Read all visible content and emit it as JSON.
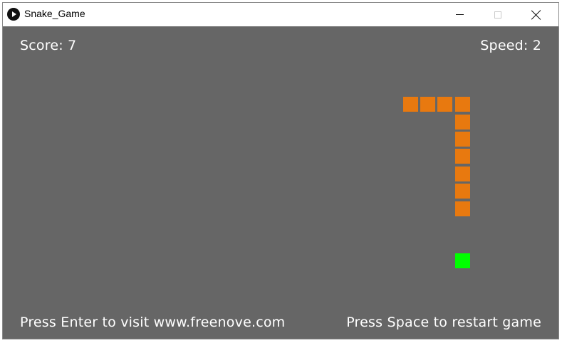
{
  "window": {
    "title": "Snake_Game",
    "app_icon": "play-icon",
    "controls": [
      "minimize-icon",
      "maximize-icon",
      "close-icon"
    ]
  },
  "hud": {
    "score_text": "Score: 7",
    "speed_text": "Speed: 2",
    "enter_hint": "Press Enter to visit www.freenove.com",
    "space_hint": "Press Space to restart game"
  },
  "game": {
    "colors": {
      "background": "#666666",
      "snake": "#e8790f",
      "food": "#00ff00",
      "text": "#ffffff"
    },
    "snake_segments": [
      {
        "col": 22,
        "row": 4
      },
      {
        "col": 23,
        "row": 4
      },
      {
        "col": 24,
        "row": 4
      },
      {
        "col": 25,
        "row": 4
      },
      {
        "col": 25,
        "row": 5
      },
      {
        "col": 25,
        "row": 6
      },
      {
        "col": 25,
        "row": 7
      },
      {
        "col": 25,
        "row": 8
      },
      {
        "col": 25,
        "row": 9
      },
      {
        "col": 25,
        "row": 10
      }
    ],
    "food": {
      "col": 25,
      "row": 13
    }
  }
}
